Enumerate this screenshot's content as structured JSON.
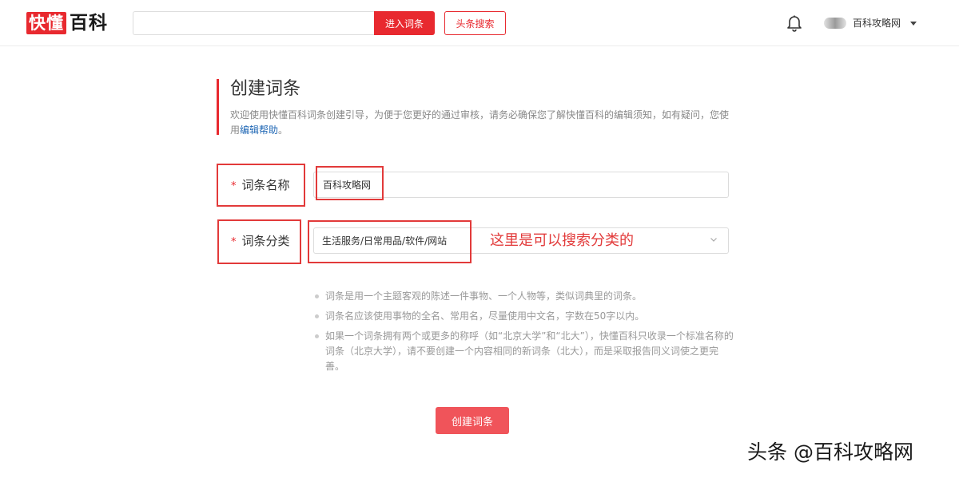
{
  "header": {
    "logo_red": "快懂",
    "logo_black": "百科",
    "search_value": "",
    "enter_button": "进入词条",
    "toutiao_button": "头条搜索",
    "username": "百科攻略网"
  },
  "intro": {
    "title": "创建词条",
    "text_before": "欢迎使用快懂百科词条创建引导，为便于您更好的通过审核，请务必确保您了解快懂百科的编辑须知，如有疑问，您使用",
    "help_link": "编辑帮助",
    "text_after": "。"
  },
  "form": {
    "star": "*",
    "name_label": "词条名称",
    "name_value": "百科攻略网",
    "category_label": "词条分类",
    "category_value": "生活服务/日常用品/软件/网站"
  },
  "annotation": "这里是可以搜索分类的",
  "tips": [
    "词条是用一个主题客观的陈述一件事物、一个人物等，类似词典里的词条。",
    "词条名应该使用事物的全名、常用名，尽量使用中文名，字数在50字以内。",
    "如果一个词条拥有两个或更多的称呼（如“北京大学”和“北大”），快懂百科只收录一个标准名称的词条（北京大学），请不要创建一个内容相同的新词条（北大），而是采取报告同义词使之更完善。"
  ],
  "create_button": "创建词条",
  "watermark": "头条 @百科攻略网",
  "colors": {
    "brand_red": "#e8292f",
    "button_red": "#f0545a",
    "annotation_red": "#e23a3a",
    "link_blue": "#1e66b4"
  },
  "icons": {
    "bell": "bell-icon",
    "caret": "caret-down-icon",
    "chevron": "chevron-down-icon"
  }
}
